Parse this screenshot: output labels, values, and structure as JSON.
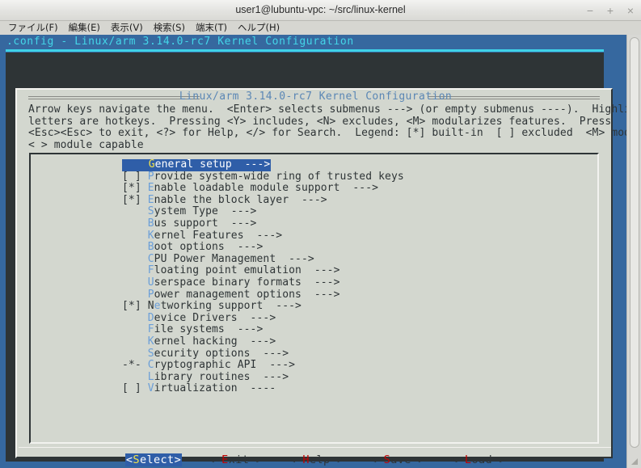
{
  "window": {
    "title": "user1@lubuntu-vpc: ~/src/linux-kernel",
    "controls": {
      "minimize": "−",
      "maximize": "+",
      "close": "×"
    }
  },
  "menubar": {
    "items": [
      {
        "label": "ファイル(F)"
      },
      {
        "label": "編集(E)"
      },
      {
        "label": "表示(V)"
      },
      {
        "label": "検索(S)"
      },
      {
        "label": "端末(T)"
      },
      {
        "label": "ヘルプ(H)"
      }
    ]
  },
  "terminal": {
    "header": ".config - Linux/arm 3.14.0-rc7 Kernel Configuration"
  },
  "dialog": {
    "title": " Linux/arm 3.14.0-rc7 Kernel Configuration ",
    "help": "Arrow keys navigate the menu.  <Enter> selects submenus ---> (or empty submenus ----).  Highlighted\nletters are hotkeys.  Pressing <Y> includes, <N> excludes, <M> modularizes features.  Press\n<Esc><Esc> to exit, <?> for Help, </> for Search.  Legend: [*] built-in  [ ] excluded  <M> module\n< > module capable",
    "menu": [
      {
        "tag": "    ",
        "pre": "",
        "hot": "G",
        "post": "eneral setup  --->",
        "selected": true
      },
      {
        "tag": "[ ] ",
        "pre": "",
        "hot": "P",
        "post": "rovide system-wide ring of trusted keys",
        "selected": false
      },
      {
        "tag": "[*] ",
        "pre": "",
        "hot": "E",
        "post": "nable loadable module support  --->",
        "selected": false
      },
      {
        "tag": "[*] ",
        "pre": "",
        "hot": "E",
        "post": "nable the block layer  --->",
        "selected": false
      },
      {
        "tag": "    ",
        "pre": "",
        "hot": "S",
        "post": "ystem Type  --->",
        "selected": false
      },
      {
        "tag": "    ",
        "pre": "",
        "hot": "B",
        "post": "us support  --->",
        "selected": false
      },
      {
        "tag": "    ",
        "pre": "",
        "hot": "K",
        "post": "ernel Features  --->",
        "selected": false
      },
      {
        "tag": "    ",
        "pre": "",
        "hot": "B",
        "post": "oot options  --->",
        "selected": false
      },
      {
        "tag": "    ",
        "pre": "",
        "hot": "C",
        "post": "PU Power Management  --->",
        "selected": false
      },
      {
        "tag": "    ",
        "pre": "",
        "hot": "F",
        "post": "loating point emulation  --->",
        "selected": false
      },
      {
        "tag": "    ",
        "pre": "",
        "hot": "U",
        "post": "serspace binary formats  --->",
        "selected": false
      },
      {
        "tag": "    ",
        "pre": "",
        "hot": "P",
        "post": "ower management options  --->",
        "selected": false
      },
      {
        "tag": "[*] ",
        "pre": "N",
        "hot": "e",
        "post": "tworking support  --->",
        "selected": false
      },
      {
        "tag": "    ",
        "pre": "",
        "hot": "D",
        "post": "evice Drivers  --->",
        "selected": false
      },
      {
        "tag": "    ",
        "pre": "",
        "hot": "F",
        "post": "ile systems  --->",
        "selected": false
      },
      {
        "tag": "    ",
        "pre": "",
        "hot": "K",
        "post": "ernel hacking  --->",
        "selected": false
      },
      {
        "tag": "    ",
        "pre": "",
        "hot": "S",
        "post": "ecurity options  --->",
        "selected": false
      },
      {
        "tag": "-*- ",
        "pre": "",
        "hot": "C",
        "post": "ryptographic API  --->",
        "selected": false
      },
      {
        "tag": "    ",
        "pre": "",
        "hot": "L",
        "post": "ibrary routines  --->",
        "selected": false
      },
      {
        "tag": "[ ] ",
        "pre": "",
        "hot": "V",
        "post": "irtualization  ----",
        "selected": false
      }
    ],
    "buttons": [
      {
        "lead": "<",
        "pre": "",
        "hot": "S",
        "post": "elect",
        "trail": ">",
        "active": true
      },
      {
        "lead": "< ",
        "pre": "",
        "hot": "E",
        "post": "xit",
        "trail": " >",
        "active": false
      },
      {
        "lead": "< ",
        "pre": "",
        "hot": "H",
        "post": "elp",
        "trail": " >",
        "active": false
      },
      {
        "lead": "< ",
        "pre": "",
        "hot": "S",
        "post": "ave",
        "trail": " >",
        "active": false
      },
      {
        "lead": "< ",
        "pre": "",
        "hot": "L",
        "post": "oad",
        "trail": " >",
        "active": false
      }
    ]
  },
  "colors": {
    "terminal_blue": "#36689f",
    "cyan_header": "#3fd2e8",
    "dialog_bg": "#d3d7cf",
    "select_blue": "#2f5ea8",
    "hotkey_blue": "#6a9ed8",
    "hotkey_yellow": "#f2e34c",
    "button_hotkey_red": "#c00000",
    "terminal_dark": "#2e3436"
  }
}
